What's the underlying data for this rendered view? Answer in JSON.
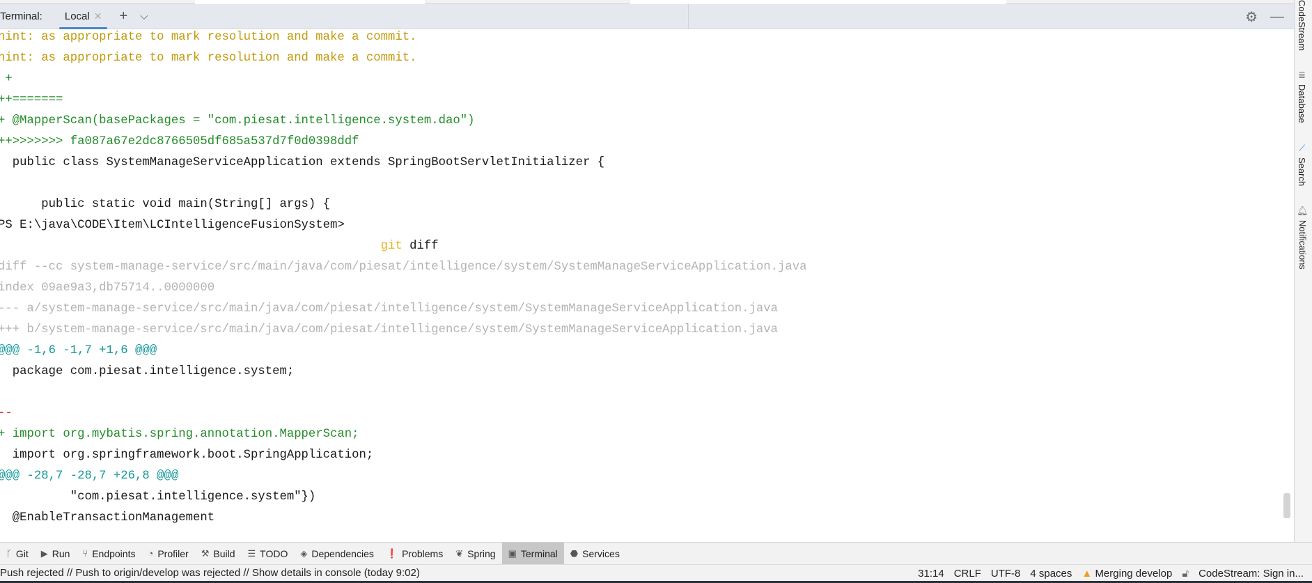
{
  "terminal": {
    "label": "Terminal:",
    "tabs": [
      {
        "label": "Local"
      }
    ],
    "lines": [
      {
        "text": "hint: as appropriate to mark resolution and make a commit.",
        "style": "hint"
      },
      {
        "text": "hint: as appropriate to mark resolution and make a commit.",
        "style": "hint"
      },
      {
        "text": " +",
        "style": "grn"
      },
      {
        "text": "++=======",
        "style": "grn"
      },
      {
        "text": "+ @MapperScan(basePackages = \"com.piesat.intelligence.system.dao\")",
        "style": "grn"
      },
      {
        "text": "++>>>>>>> fa087a67e2dc8766505df685a537d7f0d0398ddf",
        "style": "grn"
      },
      {
        "text": "  public class SystemManageServiceApplication extends SpringBootServletInitializer {",
        "style": ""
      },
      {
        "text": "",
        "style": ""
      },
      {
        "text": "      public static void main(String[] args) {",
        "style": ""
      },
      {
        "text": "PS E:\\java\\CODE\\Item\\LCIntelligenceFusionSystem>",
        "style": ""
      },
      {
        "text": "",
        "style": "",
        "cmd": "git",
        "arg": " diff"
      },
      {
        "text": "diff --cc system-manage-service/src/main/java/com/piesat/intelligence/system/SystemManageServiceApplication.java",
        "style": "gry"
      },
      {
        "text": "index 09ae9a3,db75714..0000000",
        "style": "gry"
      },
      {
        "text": "--- a/system-manage-service/src/main/java/com/piesat/intelligence/system/SystemManageServiceApplication.java",
        "style": "gry"
      },
      {
        "text": "+++ b/system-manage-service/src/main/java/com/piesat/intelligence/system/SystemManageServiceApplication.java",
        "style": "gry"
      },
      {
        "text": "@@@ -1,6 -1,7 +1,6 @@@",
        "style": "teal"
      },
      {
        "text": "  package com.piesat.intelligence.system;",
        "style": ""
      },
      {
        "text": "",
        "style": ""
      },
      {
        "text": "--",
        "style": "red"
      },
      {
        "text": "+ import org.mybatis.spring.annotation.MapperScan;",
        "style": "grn"
      },
      {
        "text": "  import org.springframework.boot.SpringApplication;",
        "style": ""
      },
      {
        "text": "@@@ -28,7 -28,7 +26,8 @@@",
        "style": "teal"
      },
      {
        "text": "          \"com.piesat.intelligence.system\"})",
        "style": ""
      },
      {
        "text": "  @EnableTransactionManagement",
        "style": ""
      }
    ]
  },
  "right_sidebar": [
    {
      "label": "CodeStream",
      "icon": "none"
    },
    {
      "label": "Database",
      "icon": "database-icon"
    },
    {
      "label": "Search",
      "icon": "feather-icon"
    },
    {
      "label": "Notifications",
      "icon": "bell-icon"
    }
  ],
  "toolbar": [
    {
      "label": "Git",
      "icon": "git-branch-icon"
    },
    {
      "label": "Run",
      "icon": "play-icon"
    },
    {
      "label": "Endpoints",
      "icon": "endpoints-icon"
    },
    {
      "label": "Profiler",
      "icon": "profiler-icon"
    },
    {
      "label": "Build",
      "icon": "hammer-icon"
    },
    {
      "label": "TODO",
      "icon": "list-icon"
    },
    {
      "label": "Dependencies",
      "icon": "layers-icon"
    },
    {
      "label": "Problems",
      "icon": "exclamation-icon"
    },
    {
      "label": "Spring",
      "icon": "leaf-icon"
    },
    {
      "label": "Terminal",
      "icon": "terminal-icon",
      "selected": true
    },
    {
      "label": "Services",
      "icon": "services-icon"
    }
  ],
  "status": {
    "message": "Push rejected // Push to origin/develop was rejected // Show details in console (today 9:02)",
    "position": "31:14",
    "line_ending": "CRLF",
    "encoding": "UTF-8",
    "indent": "4 spaces",
    "branch": "Merging develop",
    "codestream": "CodeStream:  Sign in..."
  },
  "colors": {
    "hint": "#c19a0d",
    "added": "#248c2a",
    "meta": "#b4b4b4",
    "hunk": "#14989a",
    "removed": "#d8261e",
    "command": "#e6b422",
    "tab_underline": "#4a86c8"
  }
}
